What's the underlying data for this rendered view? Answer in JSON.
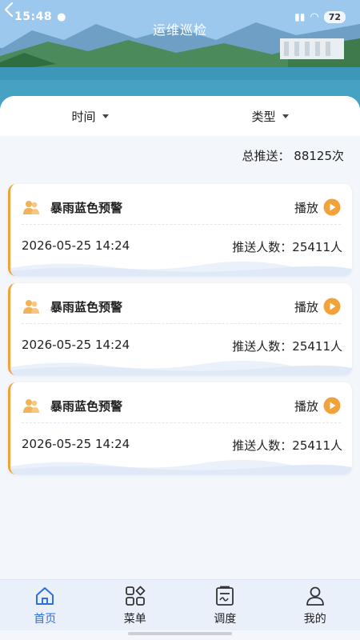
{
  "status_bar": {
    "time": "15:48",
    "battery": "72"
  },
  "header": {
    "title": "运维巡检"
  },
  "filters": [
    {
      "label": "时间"
    },
    {
      "label": "类型"
    }
  ],
  "summary": {
    "total_label": "总推送：",
    "total_value": "88125次"
  },
  "cards": [
    {
      "title": "暴雨蓝色预警",
      "play_label": "播放",
      "datetime": "2026-05-25 14:24",
      "count_label": "推送人数：",
      "count_value": "25411人"
    },
    {
      "title": "暴雨蓝色预警",
      "play_label": "播放",
      "datetime": "2026-05-25 14:24",
      "count_label": "推送人数：",
      "count_value": "25411人"
    },
    {
      "title": "暴雨蓝色预警",
      "play_label": "播放",
      "datetime": "2026-05-25 14:24",
      "count_label": "推送人数：",
      "count_value": "25411人"
    }
  ],
  "nav": [
    {
      "label": "首页",
      "icon": "home-icon",
      "active": true
    },
    {
      "label": "菜单",
      "icon": "grid-icon",
      "active": false
    },
    {
      "label": "调度",
      "icon": "clipboard-icon",
      "active": false
    },
    {
      "label": "我的",
      "icon": "user-icon",
      "active": false
    }
  ],
  "colors": {
    "accent": "#2f6fd6",
    "card_border": "#f2a23a",
    "play": "#f2a23a"
  }
}
